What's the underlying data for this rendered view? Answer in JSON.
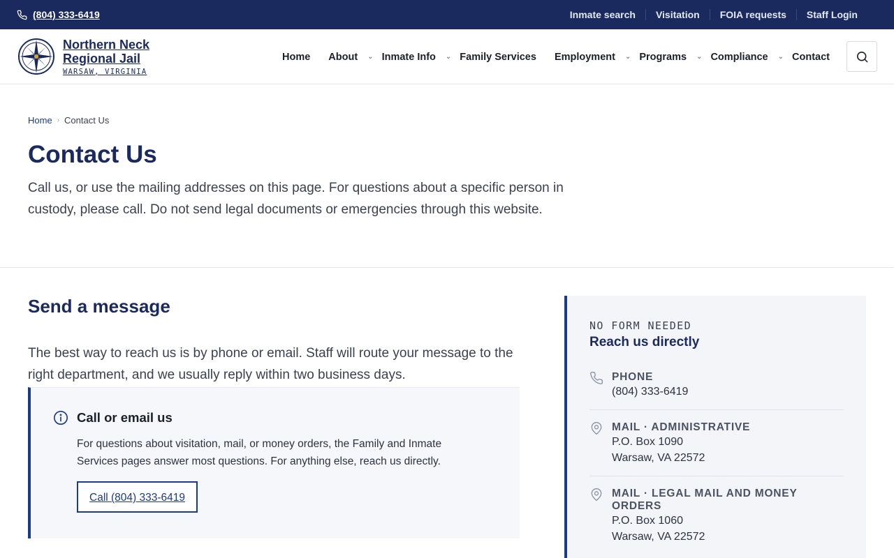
{
  "utility": {
    "phone": "(804) 333-6419",
    "links": [
      "Inmate search",
      "Visitation",
      "FOIA requests",
      "Staff Login"
    ]
  },
  "brand": {
    "line1": "Northern Neck",
    "line2": "Regional Jail",
    "location": "WARSAW, VIRGINIA"
  },
  "nav": {
    "home": "Home",
    "about": "About",
    "inmate_info": "Inmate Info",
    "family_services": "Family Services",
    "employment": "Employment",
    "programs": "Programs",
    "compliance": "Compliance",
    "contact": "Contact",
    "chevron": "⌄"
  },
  "breadcrumb": {
    "home": "Home",
    "separator": "›",
    "current": "Contact Us"
  },
  "intro": {
    "title": "Contact Us",
    "text": "Call us, or use the mailing addresses on this page. For questions about a specific person in custody, please call. Do not send legal documents or emergencies through this website."
  },
  "message": {
    "title": "Send a message",
    "lead": "The best way to reach us is by phone or email. Staff will route your message to the right department, and we usually reply within two business days.",
    "callout_title": "Call or email us",
    "callout_text": "For questions about visitation, mail, or money orders, the Family and Inmate Services pages answer most questions. For anything else, reach us directly.",
    "call_button": "Call (804) 333-6419"
  },
  "direct": {
    "kicker": "NO FORM NEEDED",
    "title": "Reach us directly",
    "phone_label": "PHONE",
    "phone_value": "(804) 333-6419",
    "admin_label": "MAIL · ADMINISTRATIVE",
    "admin_line1": "P.O. Box 1090",
    "admin_line2": "Warsaw, VA 22572",
    "legal_label": "MAIL · LEGAL MAIL AND MONEY ORDERS",
    "legal_line1": "P.O. Box 1060",
    "legal_line2": "Warsaw, VA 22572"
  },
  "colors": {
    "navy": "#1a2a5e",
    "accent": "#1a3a8a",
    "panel": "#f3f5f9"
  },
  "icons": [
    "phone-icon",
    "compass-seal-logo",
    "search-icon",
    "info-icon",
    "location-pin-icon"
  ]
}
